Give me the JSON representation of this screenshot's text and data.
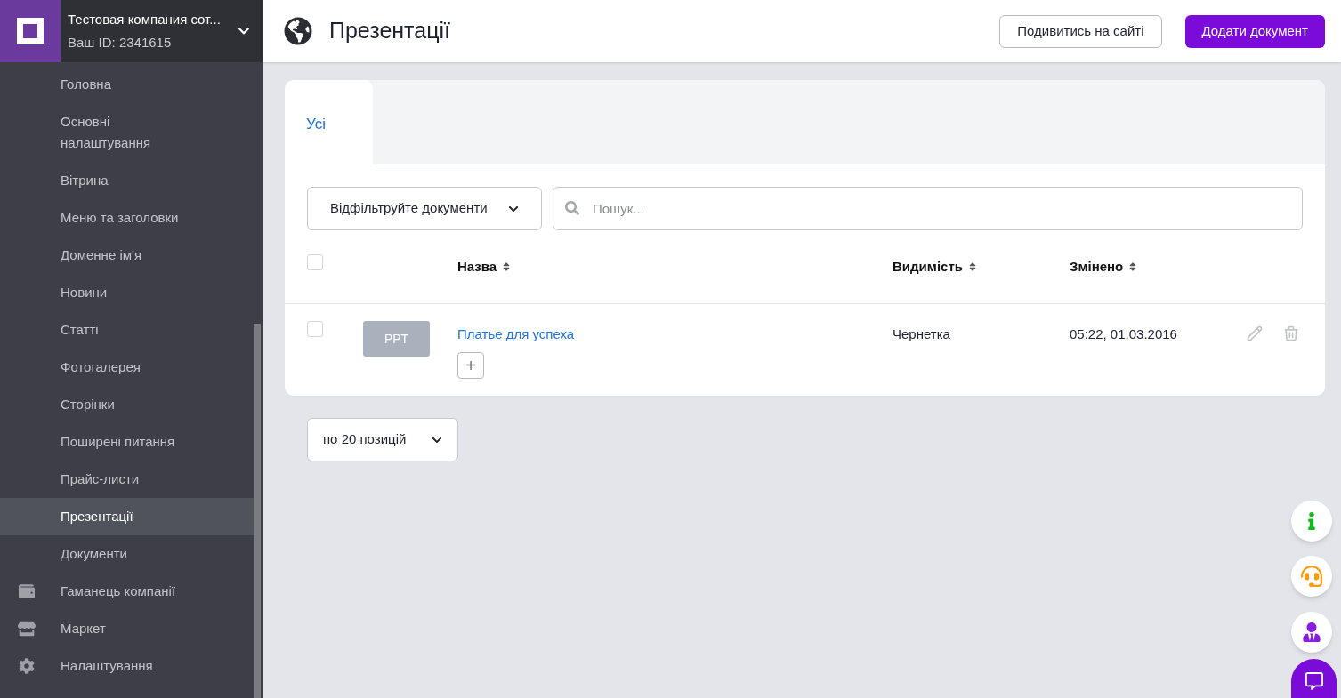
{
  "company": {
    "name": "Тестовая компания сот...",
    "id": "Ваш ID: 2341615"
  },
  "sidebar": {
    "items": [
      {
        "label": "Головна",
        "selected": false,
        "kind": "plain"
      },
      {
        "label": "Основні налаштування",
        "selected": false,
        "kind": "plain"
      },
      {
        "label": "Вітрина",
        "selected": false,
        "kind": "plain"
      },
      {
        "label": "Меню та заголовки",
        "selected": false,
        "kind": "plain"
      },
      {
        "label": "Доменне ім'я",
        "selected": false,
        "kind": "plain"
      },
      {
        "label": "Новини",
        "selected": false,
        "kind": "plain"
      },
      {
        "label": "Статті",
        "selected": false,
        "kind": "plain"
      },
      {
        "label": "Фотогалерея",
        "selected": false,
        "kind": "plain"
      },
      {
        "label": "Сторінки",
        "selected": false,
        "kind": "plain"
      },
      {
        "label": "Поширені питання",
        "selected": false,
        "kind": "plain"
      },
      {
        "label": "Прайс-листи",
        "selected": false,
        "kind": "plain"
      },
      {
        "label": "Презентації",
        "selected": true,
        "kind": "plain"
      },
      {
        "label": "Документи",
        "selected": false,
        "kind": "plain"
      },
      {
        "label": "Гаманець компанії",
        "selected": false,
        "kind": "wallet"
      },
      {
        "label": "Маркет",
        "selected": false,
        "kind": "store"
      },
      {
        "label": "Налаштування",
        "selected": false,
        "kind": "settings"
      }
    ]
  },
  "header": {
    "title": "Презентації",
    "buttons": [
      {
        "label": "Подивитись на сайті",
        "kind": "outline"
      },
      {
        "label": "Додати документ",
        "kind": "primary"
      }
    ]
  },
  "tabs": [
    {
      "label": "Усі",
      "selected": true
    }
  ],
  "filter": {
    "label": "Відфільтруйте документи"
  },
  "search": {
    "placeholder": "Пошук..."
  },
  "table": {
    "select_all_checked": false,
    "columns": [
      "Назва",
      "Видимість",
      "Змінено"
    ],
    "rows": [
      {
        "checked": false,
        "thumb": "PPT",
        "name": "Платье для успеха",
        "visibility": "Чернетка",
        "changed": "05:22, 01.03.2016",
        "add": "+"
      }
    ]
  },
  "page_size": "по 20 позицій"
}
